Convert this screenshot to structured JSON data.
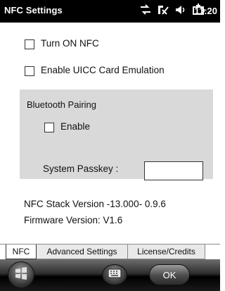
{
  "window": {
    "title": "NFC Settings",
    "clock": "11:20"
  },
  "status_icons": [
    "network-activity-icon",
    "signal-icon",
    "speaker-icon",
    "battery-charging-icon"
  ],
  "options": {
    "turn_on_nfc": {
      "label": "Turn ON NFC",
      "checked": false
    },
    "enable_uicc": {
      "label": "Enable UICC Card Emulation",
      "checked": false
    }
  },
  "bluetooth": {
    "heading": "Bluetooth Pairing",
    "enable_label": "Enable",
    "enable_checked": false,
    "passkey_label": "System Passkey :",
    "passkey_value": ""
  },
  "info": {
    "stack_version": "NFC Stack Version -13.000-  0.9.6",
    "firmware_version": "Firmware Version:   V1.6"
  },
  "tabs": [
    {
      "label": "NFC",
      "active": true
    },
    {
      "label": "Advanced Settings",
      "active": false
    },
    {
      "label": "License/Credits",
      "active": false
    }
  ],
  "bottom": {
    "ok_label": "OK"
  }
}
